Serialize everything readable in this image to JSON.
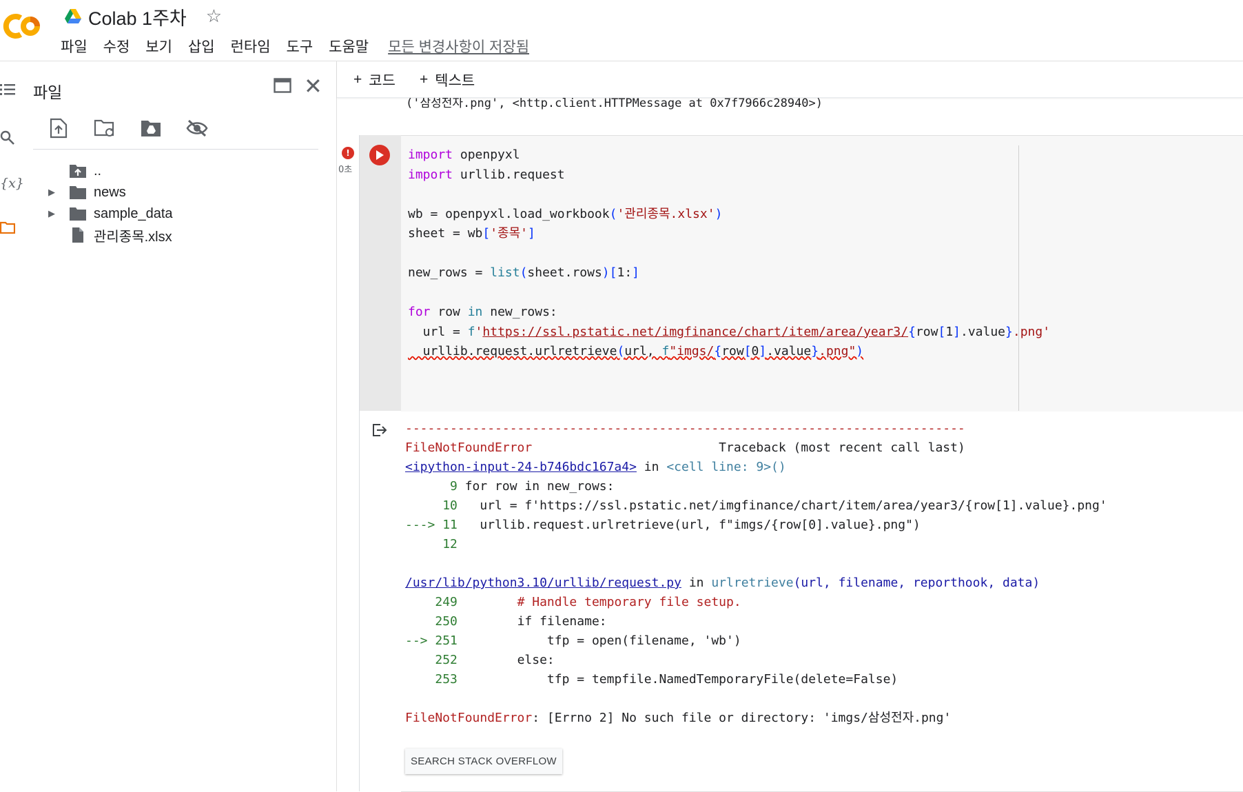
{
  "header": {
    "doc_title": "Colab 1주차",
    "menu": [
      "파일",
      "수정",
      "보기",
      "삽입",
      "런타임",
      "도구",
      "도움말"
    ],
    "save_status": "모든 변경사항이 저장됨",
    "colors": {
      "logo_orange": "#F9AB00",
      "logo_dark": "#E8710A"
    }
  },
  "sidebar": {
    "title": "파일",
    "tools": [
      "upload-file-icon",
      "refresh-folder-icon",
      "mount-drive-icon",
      "hide-files-icon"
    ],
    "tree": [
      {
        "name": "..",
        "type": "parent"
      },
      {
        "name": "news",
        "type": "folder"
      },
      {
        "name": "sample_data",
        "type": "folder"
      },
      {
        "name": "관리종목.xlsx",
        "type": "file"
      }
    ]
  },
  "toolbar": {
    "add_code": "코드",
    "add_text": "텍스트"
  },
  "prev_output": "('삼성전자.png', <http.client.HTTPMessage at 0x7f7966c28940>)",
  "cell": {
    "exec_time": "0초",
    "error_badge": "!",
    "code_lines": [
      "import openpyxl",
      "import urllib.request",
      "",
      "wb = openpyxl.load_workbook('관리종목.xlsx')",
      "sheet = wb['종목']",
      "",
      "new_rows = list(sheet.rows)[1:]",
      "",
      "for row in new_rows:",
      "  url = f'https://ssl.pstatic.net/imgfinance/chart/item/area/year3/{row[1].value}.png'",
      "  urllib.request.urlretrieve(url, f\"imgs/{row[0].value}.png\")"
    ]
  },
  "output": {
    "dashes": "---------------------------------------------------------------------------",
    "error_type": "FileNotFoundError",
    "traceback_header": "Traceback (most recent call last)",
    "frame1": {
      "file": "<ipython-input-24-b746bdc167a4>",
      "in": "in",
      "loc": "<cell line: 9>()",
      "lines": [
        {
          "marker": "      ",
          "no": "9",
          "code": " for row in new_rows:"
        },
        {
          "marker": "     ",
          "no": "10",
          "code": "   url = f'https://ssl.pstatic.net/imgfinance/chart/item/area/year3/{row[1].value}.png'"
        },
        {
          "marker": "---> ",
          "no": "11",
          "code": "   urllib.request.urlretrieve(url, f\"imgs/{row[0].value}.png\")"
        },
        {
          "marker": "     ",
          "no": "12",
          "code": ""
        }
      ]
    },
    "frame2": {
      "file": "/usr/lib/python3.10/urllib/request.py",
      "in": "in",
      "func": "urlretrieve",
      "args": "(url, filename, reporthook, data)",
      "lines": [
        {
          "marker": "    ",
          "no": "249",
          "code": "        # Handle temporary file setup."
        },
        {
          "marker": "    ",
          "no": "250",
          "code": "        if filename:"
        },
        {
          "marker": "--> ",
          "no": "251",
          "code": "            tfp = open(filename, 'wb')"
        },
        {
          "marker": "    ",
          "no": "252",
          "code": "        else:"
        },
        {
          "marker": "    ",
          "no": "253",
          "code": "            tfp = tempfile.NamedTemporaryFile(delete=False)"
        }
      ]
    },
    "final_error_type": "FileNotFoundError",
    "final_message": ": [Errno 2] No such file or directory: 'imgs/삼성전자.png'",
    "search_button": "SEARCH STACK OVERFLOW"
  }
}
